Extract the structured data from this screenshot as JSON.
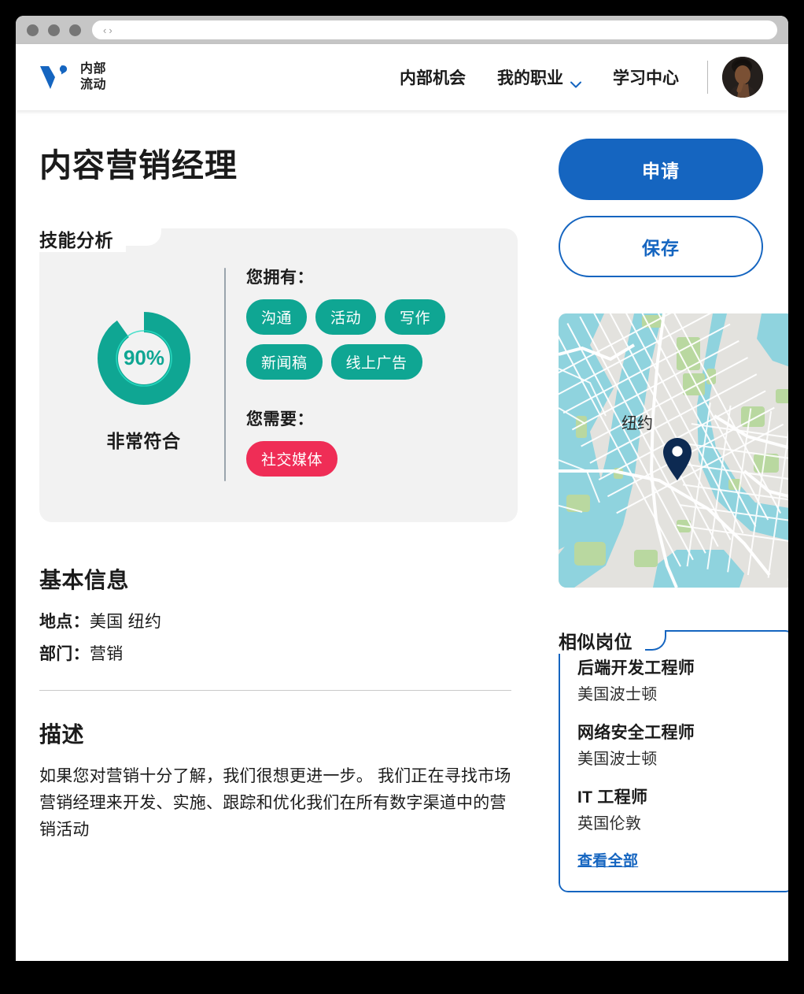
{
  "browser": {
    "traffic_lights": [
      "close",
      "minimize",
      "maximize"
    ],
    "address_value": "",
    "back_glyph": "‹",
    "forward_glyph": "›"
  },
  "header": {
    "brand": {
      "icon": "v-logo-icon",
      "line1": "内部",
      "line2": "流动"
    },
    "nav": [
      {
        "label": "内部机会",
        "has_dropdown": false
      },
      {
        "label": "我的职业",
        "has_dropdown": true
      },
      {
        "label": "学习中心",
        "has_dropdown": false
      }
    ],
    "avatar_alt": "user-avatar"
  },
  "main": {
    "job_title": "内容营销经理",
    "skill_analysis": {
      "heading": "技能分析",
      "match_percent": "90%",
      "match_value": 90,
      "match_caption": "非常符合",
      "have_label": "您拥有：",
      "have_tags": [
        "沟通",
        "活动",
        "写作",
        "新闻稿",
        "线上广告"
      ],
      "need_label": "您需要：",
      "need_tags": [
        "社交媒体"
      ]
    },
    "basic_info": {
      "heading": "基本信息",
      "rows": [
        {
          "key": "地点：",
          "value": "美国 纽约"
        },
        {
          "key": "部门：",
          "value": "营销"
        }
      ]
    },
    "description": {
      "heading": "描述",
      "body": "如果您对营销十分了解，我们很想更进一步。 我们正在寻找市场营销经理来开发、实施、跟踪和优化我们在所有数字渠道中的营销活动"
    }
  },
  "sidebar": {
    "apply_label": "申请",
    "save_label": "保存",
    "map": {
      "city_label": "纽约",
      "pin_icon": "map-pin-icon"
    },
    "similar_jobs": {
      "heading": "相似岗位",
      "items": [
        {
          "title": "后端开发工程师",
          "location": "美国波士顿"
        },
        {
          "title": "网络安全工程师",
          "location": "美国波士顿"
        },
        {
          "title": "IT 工程师",
          "location": "英国伦敦"
        }
      ],
      "see_all_label": "查看全部"
    }
  },
  "colors": {
    "brand_blue": "#1565c0",
    "teal": "#0fa693",
    "crimson": "#ef2d56",
    "pin_navy": "#0d2a52",
    "panel_bg": "#f2f2f2"
  }
}
